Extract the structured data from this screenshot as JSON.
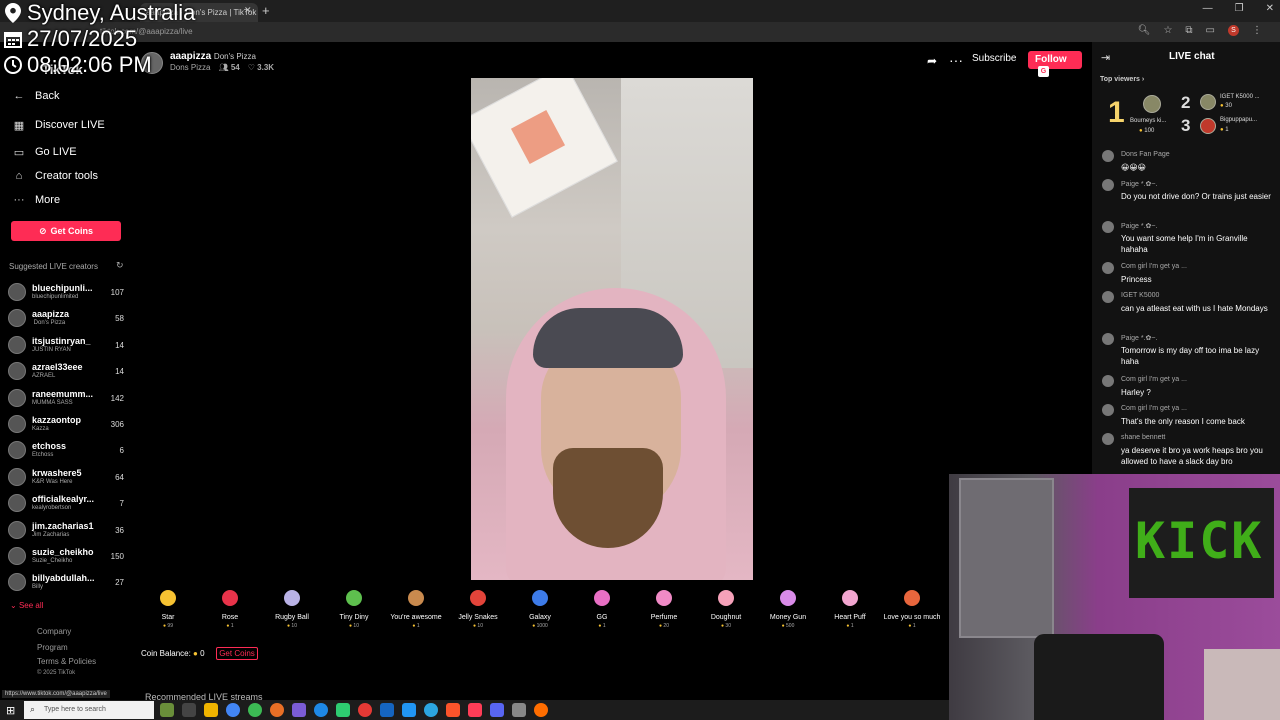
{
  "overlay": {
    "location": "Sydney, Australia",
    "date": "27/07/2025",
    "time": "08:02:06 PM"
  },
  "browser": {
    "tab_title": "aaapizza · Don's Pizza | TikTok LIVE",
    "url": "tiktok.com/@aaapizza/live"
  },
  "sidebar": {
    "logo": "TikTok",
    "nav": [
      {
        "label": "Back",
        "icon": "arrow-left-icon"
      },
      {
        "label": "Discover LIVE",
        "icon": "calendar-icon"
      },
      {
        "label": "Go LIVE",
        "icon": "video-icon"
      },
      {
        "label": "Creator tools",
        "icon": "home-icon"
      },
      {
        "label": "More",
        "icon": "more-icon"
      }
    ],
    "get_coins": "Get Coins",
    "suggested_title": "Suggested LIVE creators",
    "see_all": "See all",
    "creators": [
      {
        "name": "bluechipunli...",
        "sub": "bluechipunlimited",
        "count": "107"
      },
      {
        "name": "aaapizza",
        "sub": "⁣ Don's Pizza ⁣",
        "count": "58"
      },
      {
        "name": "itsjustinryan_",
        "sub": "JUSTIN RYAN",
        "count": "14"
      },
      {
        "name": "azrael33eee",
        "sub": "AZRAEL",
        "count": "14"
      },
      {
        "name": "raneemumm...",
        "sub": "MUMMA SASS",
        "count": "142"
      },
      {
        "name": "kazzaontop",
        "sub": "Kazza",
        "count": "306"
      },
      {
        "name": "etchoss",
        "sub": "Etchoss",
        "count": "6"
      },
      {
        "name": "krwashere5",
        "sub": "K&R Was Here",
        "count": "64"
      },
      {
        "name": "officialkealyr...",
        "sub": "kealyrobertson",
        "count": "7"
      },
      {
        "name": "jim.zacharias1",
        "sub": "Jim Zacharias",
        "count": "36"
      },
      {
        "name": "suzie_cheikho",
        "sub": "Suzie_Cheikho",
        "count": "150"
      },
      {
        "name": "billyabdullah...",
        "sub": "Billy",
        "count": "27"
      }
    ],
    "footer": [
      "Company",
      "Program",
      "Terms & Policies",
      "© 2025 TikTok"
    ]
  },
  "streamer": {
    "name": "aaapizza",
    "nickname": "Don's Pizza",
    "team": "Dons Pizza",
    "viewers": "54",
    "likes": "3.3K",
    "subscribe": "Subscribe",
    "follow": "Follow",
    "follow_badge": "G"
  },
  "gifts": [
    {
      "name": "Star",
      "price": "99",
      "icon": "star-gift-icon",
      "color": "#f6c232"
    },
    {
      "name": "Rose",
      "price": "1",
      "icon": "rose-gift-icon",
      "color": "#e8334a"
    },
    {
      "name": "Rugby Ball",
      "price": "10",
      "icon": "rugby-ball-gift-icon",
      "color": "#b9b2e6"
    },
    {
      "name": "Tiny Diny",
      "price": "10",
      "icon": "dinosaur-gift-icon",
      "color": "#5ec04e"
    },
    {
      "name": "You're awesome",
      "price": "1",
      "icon": "awesome-gift-icon",
      "color": "#c98a4e"
    },
    {
      "name": "Jelly Snakes",
      "price": "10",
      "icon": "snakes-gift-icon",
      "color": "#e2443a"
    },
    {
      "name": "Galaxy",
      "price": "1000",
      "icon": "galaxy-gift-icon",
      "color": "#3d7be8"
    },
    {
      "name": "GG",
      "price": "1",
      "icon": "gg-gift-icon",
      "color": "#e86fc4"
    },
    {
      "name": "Perfume",
      "price": "20",
      "icon": "perfume-gift-icon",
      "color": "#f08ac6"
    },
    {
      "name": "Doughnut",
      "price": "30",
      "icon": "doughnut-gift-icon",
      "color": "#f5a1b9"
    },
    {
      "name": "Money Gun",
      "price": "500",
      "icon": "money-gun-gift-icon",
      "color": "#d98be8"
    },
    {
      "name": "Heart Puff",
      "price": "1",
      "icon": "heart-puff-gift-icon",
      "color": "#f2a6d0"
    },
    {
      "name": "Love you so much",
      "price": "1",
      "icon": "love-gift-icon",
      "color": "#e8663d"
    }
  ],
  "coin_balance_label": "Coin Balance:",
  "coin_balance_value": "0",
  "coin_button": "Get Coins",
  "recommended": "Recommended LIVE streams",
  "status_url": "https://www.tiktok.com/@aaapizza/live",
  "chat": {
    "title": "LIVE chat",
    "top_viewers": "Top viewers",
    "viewers": [
      {
        "rank": "1",
        "name": "Bourneys ki...",
        "coins": "100"
      },
      {
        "rank": "2",
        "name": "IGET K5000 ...",
        "coins": "30"
      },
      {
        "rank": "3",
        "name": "Bigpuppapu...",
        "coins": "1"
      }
    ],
    "messages": [
      {
        "user": "Dons Fan Page",
        "text": "😀😀😀"
      },
      {
        "user": "Paige *.✿~.",
        "text": "Do you not drive don? Or trains just easier"
      },
      {
        "user": "Paige *.✿~.",
        "text": "You want some help I'm in Granville hahaha"
      },
      {
        "user": "Com girl I'm get ya ...",
        "text": "Princess"
      },
      {
        "user": "IGET K5000",
        "text": "can ya atleast eat with us I hate Mondays"
      },
      {
        "user": "Paige *.✿~.",
        "text": "Tomorrow is my day off too ima be lazy haha"
      },
      {
        "user": "Com girl I'm get ya ...",
        "text": "Harley ?"
      },
      {
        "user": "Com girl I'm get ya ...",
        "text": "That's the only reason I come back"
      },
      {
        "user": "shane bennett",
        "text": "ya deserve it bro ya work heaps bro you allowed to have a slack day bro"
      }
    ]
  },
  "webcam": {
    "flag_text": "KICK"
  },
  "taskbar": {
    "search_placeholder": "Type here to search"
  }
}
